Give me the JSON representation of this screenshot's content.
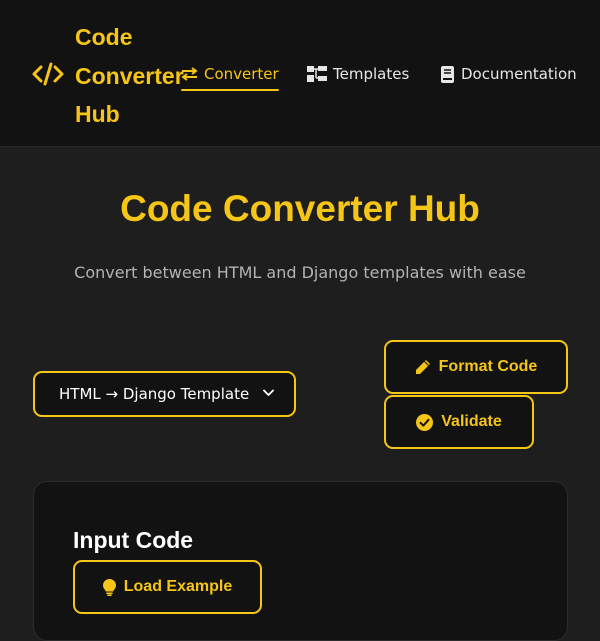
{
  "header": {
    "logo_icon": "code-brackets-icon",
    "logo_text": "Code Converter Hub",
    "nav": [
      {
        "label": "Converter",
        "icon": "swap-arrows-icon",
        "active": true
      },
      {
        "label": "Templates",
        "icon": "sitemap-icon",
        "active": false
      },
      {
        "label": "Documentation",
        "icon": "book-icon",
        "active": false
      }
    ]
  },
  "main": {
    "title": "Code Converter Hub",
    "subtitle": "Convert between HTML and Django templates with ease",
    "conversion_select": {
      "value": "HTML → Django Template",
      "icon": "chevron-down-icon"
    },
    "actions": {
      "format_label": "Format Code",
      "format_icon": "pencil-icon",
      "validate_label": "Validate",
      "validate_icon": "check-circle-icon"
    },
    "input_panel": {
      "title": "Input Code",
      "load_example_label": "Load Example",
      "load_example_icon": "lightbulb-icon"
    }
  },
  "colors": {
    "accent": "#f5c518",
    "background": "#1e1e1e",
    "header_background": "#121212",
    "text": "#ffffff",
    "muted_text": "#b3b3b3"
  }
}
